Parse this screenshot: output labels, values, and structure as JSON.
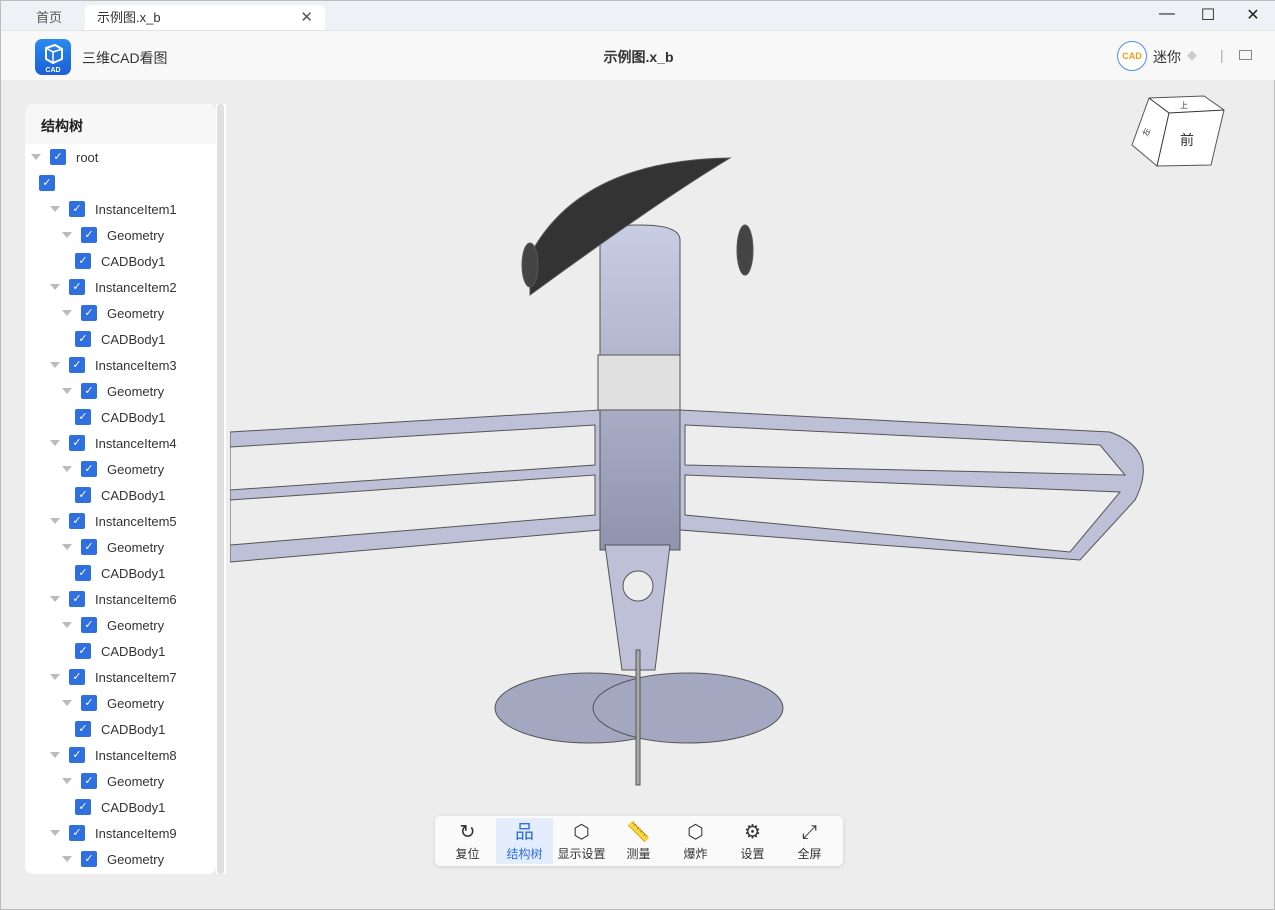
{
  "tabs": {
    "home": "首页",
    "active": "示例图.x_b"
  },
  "header": {
    "app_name": "三维CAD看图",
    "doc_title": "示例图.x_b",
    "logo_text": "CAD",
    "user": "迷你"
  },
  "tree": {
    "title": "结构树",
    "rows": [
      {
        "label": "root",
        "level": 0,
        "toggle": true
      },
      {
        "label": "",
        "level": 1,
        "toggle": false
      },
      {
        "label": "InstanceItem1",
        "level": 2,
        "toggle": true
      },
      {
        "label": "Geometry",
        "level": 3,
        "toggle": true
      },
      {
        "label": "CADBody1",
        "level": 4,
        "toggle": false
      },
      {
        "label": "InstanceItem2",
        "level": 2,
        "toggle": true
      },
      {
        "label": "Geometry",
        "level": 3,
        "toggle": true
      },
      {
        "label": "CADBody1",
        "level": 4,
        "toggle": false
      },
      {
        "label": "InstanceItem3",
        "level": 2,
        "toggle": true
      },
      {
        "label": "Geometry",
        "level": 3,
        "toggle": true
      },
      {
        "label": "CADBody1",
        "level": 4,
        "toggle": false
      },
      {
        "label": "InstanceItem4",
        "level": 2,
        "toggle": true
      },
      {
        "label": "Geometry",
        "level": 3,
        "toggle": true
      },
      {
        "label": "CADBody1",
        "level": 4,
        "toggle": false
      },
      {
        "label": "InstanceItem5",
        "level": 2,
        "toggle": true
      },
      {
        "label": "Geometry",
        "level": 3,
        "toggle": true
      },
      {
        "label": "CADBody1",
        "level": 4,
        "toggle": false
      },
      {
        "label": "InstanceItem6",
        "level": 2,
        "toggle": true
      },
      {
        "label": "Geometry",
        "level": 3,
        "toggle": true
      },
      {
        "label": "CADBody1",
        "level": 4,
        "toggle": false
      },
      {
        "label": "InstanceItem7",
        "level": 2,
        "toggle": true
      },
      {
        "label": "Geometry",
        "level": 3,
        "toggle": true
      },
      {
        "label": "CADBody1",
        "level": 4,
        "toggle": false
      },
      {
        "label": "InstanceItem8",
        "level": 2,
        "toggle": true
      },
      {
        "label": "Geometry",
        "level": 3,
        "toggle": true
      },
      {
        "label": "CADBody1",
        "level": 4,
        "toggle": false
      },
      {
        "label": "InstanceItem9",
        "level": 2,
        "toggle": true
      },
      {
        "label": "Geometry",
        "level": 3,
        "toggle": true
      }
    ]
  },
  "view_cube": {
    "front": "前",
    "top": "上",
    "left": "左"
  },
  "toolbar": [
    {
      "label": "复位",
      "icon": "reset-icon",
      "glyph": "↻"
    },
    {
      "label": "结构树",
      "icon": "tree-icon",
      "glyph": "品",
      "active": true
    },
    {
      "label": "显示设置",
      "icon": "display-settings-icon",
      "glyph": "⬡"
    },
    {
      "label": "测量",
      "icon": "ruler-icon",
      "glyph": "📏"
    },
    {
      "label": "爆炸",
      "icon": "explode-icon",
      "glyph": "⬡"
    },
    {
      "label": "设置",
      "icon": "settings-icon",
      "glyph": "⚙"
    },
    {
      "label": "全屏",
      "icon": "fullscreen-icon",
      "glyph": "⤢"
    }
  ]
}
